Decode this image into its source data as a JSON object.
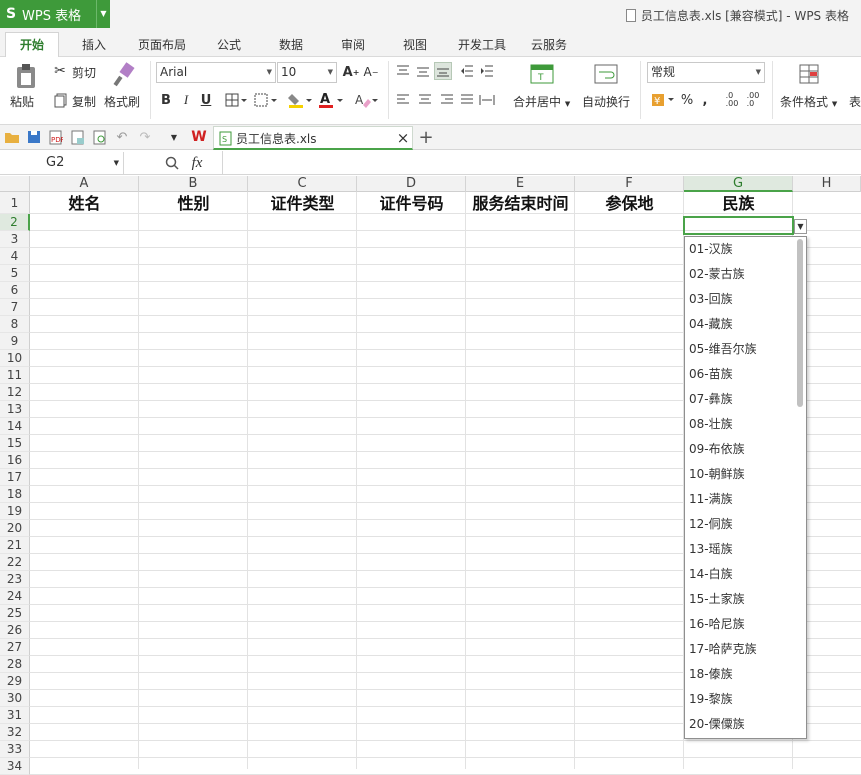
{
  "app": {
    "name": "WPS 表格",
    "logo": "S",
    "title": "员工信息表.xls [兼容模式] - WPS 表格"
  },
  "tabs": [
    "开始",
    "插入",
    "页面布局",
    "公式",
    "数据",
    "审阅",
    "视图",
    "开发工具",
    "云服务"
  ],
  "ribbon": {
    "paste": "粘贴",
    "cut": "剪切",
    "copy": "复制",
    "format_painter": "格式刷",
    "font": "Arial",
    "font_size": "10",
    "merge_center": "合并居中",
    "wrap_text": "自动换行",
    "number_format": "常规",
    "conditional_format": "条件格式",
    "table_style": "表"
  },
  "file_tab": {
    "name": "员工信息表.xls",
    "close": "×",
    "new_tab": "+"
  },
  "formula_bar": {
    "cell_ref": "G2",
    "fx": "fx"
  },
  "columns": [
    "A",
    "B",
    "C",
    "D",
    "E",
    "F",
    "G",
    "H"
  ],
  "rows": [
    "1",
    "2",
    "3",
    "4",
    "5",
    "6",
    "7",
    "8",
    "9",
    "10",
    "11",
    "12",
    "13",
    "14",
    "15",
    "16",
    "17",
    "18",
    "19",
    "20",
    "21",
    "22",
    "23",
    "24",
    "25",
    "26",
    "27",
    "28",
    "29",
    "30",
    "31",
    "32",
    "33",
    "34"
  ],
  "header_row": [
    "姓名",
    "性别",
    "证件类型",
    "证件号码",
    "服务结束时间",
    "参保地",
    "民族"
  ],
  "dropdown_options": [
    "01-汉族",
    "02-蒙古族",
    "03-回族",
    "04-藏族",
    "05-维吾尔族",
    "06-苗族",
    "07-彝族",
    "08-壮族",
    "09-布依族",
    "10-朝鲜族",
    "11-满族",
    "12-侗族",
    "13-瑶族",
    "14-白族",
    "15-土家族",
    "16-哈尼族",
    "17-哈萨克族",
    "18-傣族",
    "19-黎族",
    "20-傈僳族"
  ],
  "colors": {
    "accent": "#3e9a3a",
    "selection": "#4aa349"
  }
}
